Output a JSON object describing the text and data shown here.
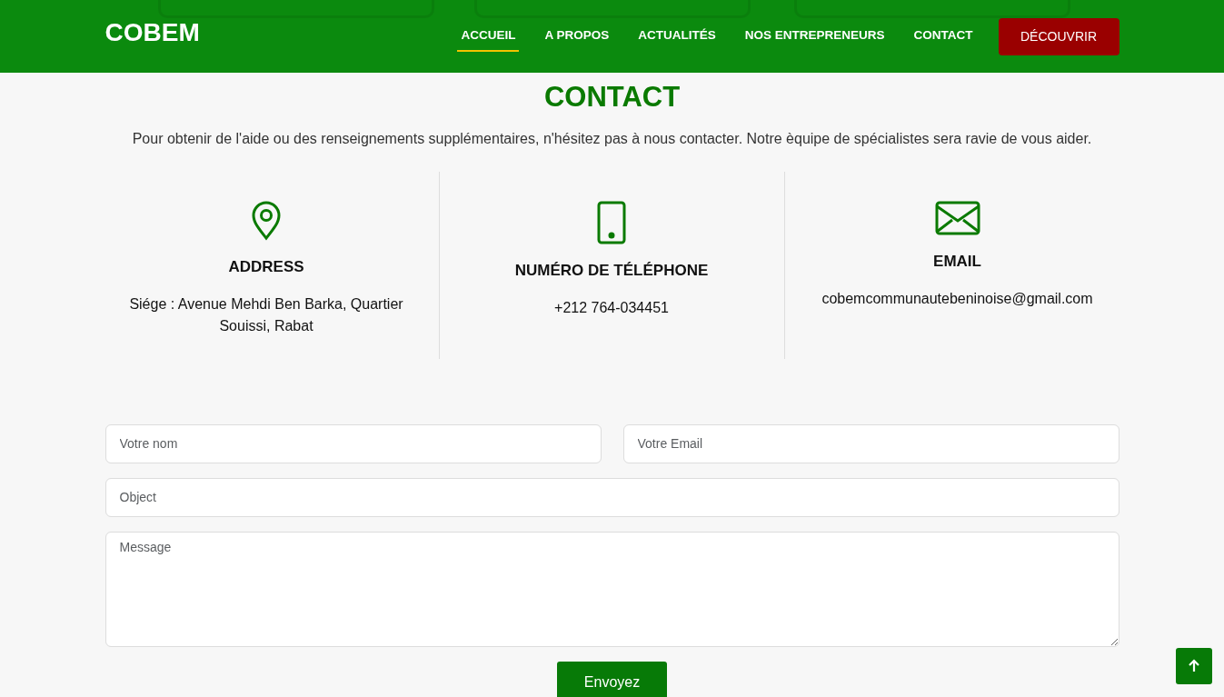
{
  "brand": "COBEM",
  "nav": [
    {
      "label": "ACCUEIL",
      "selected": true
    },
    {
      "label": "A PROPOS",
      "selected": false
    },
    {
      "label": "ACTUALITÉS",
      "selected": false
    },
    {
      "label": "NOS ENTREPRENEURS",
      "selected": false
    },
    {
      "label": "CONTACT",
      "selected": false
    }
  ],
  "cta": "DÉCOUVRIR",
  "heading": "CONTACT",
  "intro": "Pour obtenir de l'aide ou des renseignements supplémentaires, n'hésitez pas à nous contacter. Notre èquipe de spécialistes sera ravie de vous aider.",
  "contacts": [
    {
      "kind": "address",
      "title": "ADDRESS",
      "text": "Siége : Avenue Mehdi Ben Barka, Quartier Souissi, Rabat"
    },
    {
      "kind": "phone",
      "title": "NUMÉRO DE TÉLÉPHONE",
      "text": "+212 764-034451"
    },
    {
      "kind": "email",
      "title": "EMAIL",
      "text": "cobemcommunautebeninoise@gmail.com"
    }
  ],
  "form": {
    "name": {
      "placeholder": "Votre nom"
    },
    "email": {
      "placeholder": "Votre Email"
    },
    "subject": {
      "placeholder": "Object"
    },
    "message": {
      "placeholder": "Message"
    },
    "submit": "Envoyez"
  }
}
